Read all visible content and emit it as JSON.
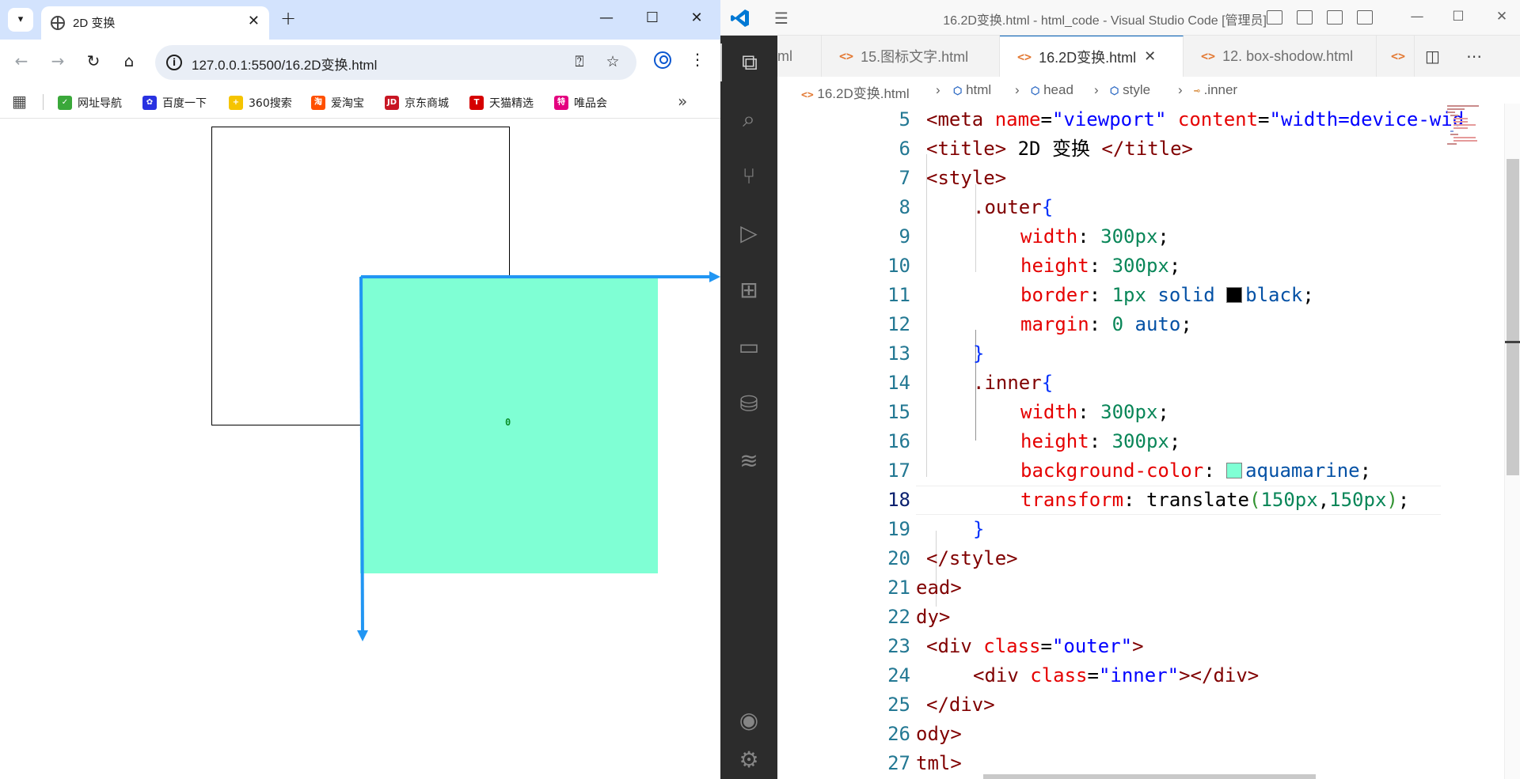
{
  "browser": {
    "tab_title": "2D 变换",
    "url": "127.0.0.1:5500/16.2D变换.html",
    "bookmarks": [
      {
        "label": "网址导航",
        "color": "#3aa83a",
        "glyph": "✓"
      },
      {
        "label": "百度一下",
        "color": "#2932e1",
        "glyph": "✿"
      },
      {
        "label": "360搜索",
        "color": "#f5c400",
        "glyph": "+"
      },
      {
        "label": "爱淘宝",
        "color": "#ff5000",
        "glyph": "淘"
      },
      {
        "label": "京东商城",
        "color": "#c81623",
        "glyph": "JD"
      },
      {
        "label": "天猫精选",
        "color": "#d50000",
        "glyph": "T"
      },
      {
        "label": "唯品会",
        "color": "#e4007f",
        "glyph": "特"
      }
    ],
    "page": {
      "origin_label": "0",
      "outer_border_color": "#000000",
      "inner_color": "#7fffd4",
      "axis_color": "#2196f3"
    }
  },
  "vscode": {
    "title": "16.2D变换.html - html_code - Visual Studio Code [管理员]",
    "tabs": [
      {
        "label": "ml",
        "active": false
      },
      {
        "label": "15.图标文字.html",
        "active": false
      },
      {
        "label": "16.2D变换.html",
        "active": true
      },
      {
        "label": "12. box-shodow.html",
        "active": false
      }
    ],
    "breadcrumb": [
      "16.2D变换.html",
      "html",
      "head",
      "style",
      ".inner"
    ],
    "line_numbers": [
      "5",
      "6",
      "7",
      "8",
      "9",
      "10",
      "11",
      "12",
      "13",
      "14",
      "15",
      "16",
      "17",
      "18",
      "19",
      "20",
      "21",
      "22",
      "23",
      "24",
      "25",
      "26",
      "27"
    ],
    "current_line": "18",
    "code": {
      "l5": [
        "<meta",
        " name",
        "=",
        "\"viewport\"",
        " content",
        "=",
        "\"width=device-wid"
      ],
      "l6": [
        "<title>",
        " 2D 变换 ",
        "</title>"
      ],
      "l7": [
        "<style>"
      ],
      "l8": [
        ".outer",
        "{"
      ],
      "l9": [
        "width",
        ": ",
        "300px",
        ";"
      ],
      "l10": [
        "height",
        ": ",
        "300px",
        ";"
      ],
      "l11": [
        "border",
        ": ",
        "1px",
        " solid ",
        "black",
        ";"
      ],
      "l12": [
        "margin",
        ": ",
        "0",
        " auto",
        ";"
      ],
      "l13": [
        "}"
      ],
      "l14": [
        ".inner",
        "{"
      ],
      "l15": [
        "width",
        ": ",
        "300px",
        ";"
      ],
      "l16": [
        "height",
        ": ",
        "300px",
        ";"
      ],
      "l17": [
        "background-color",
        ": ",
        "aquamarine",
        ";"
      ],
      "l18": [
        "transform",
        ": ",
        "translate",
        "(",
        "150px",
        ",",
        "150px",
        ")",
        ";"
      ],
      "l19": [
        "}"
      ],
      "l20": [
        "</style>"
      ],
      "l21": [
        "ead>"
      ],
      "l22": [
        "dy>"
      ],
      "l23": [
        "<div",
        " class",
        "=",
        "\"outer\"",
        ">"
      ],
      "l24": [
        "<div",
        " class",
        "=",
        "\"inner\"",
        "></div>"
      ],
      "l25": [
        "</div>"
      ],
      "l26": [
        "ody>"
      ],
      "l27": [
        "tml>"
      ]
    },
    "swatch_black": "#000000",
    "swatch_aquamarine": "#7fffd4"
  }
}
